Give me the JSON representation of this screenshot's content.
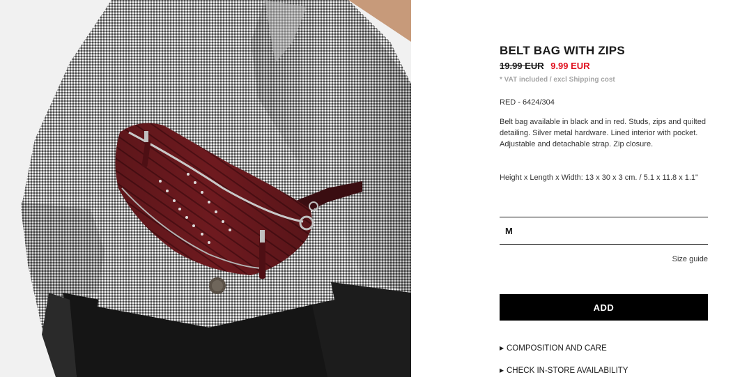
{
  "product": {
    "title": "BELT BAG WITH ZIPS",
    "old_price": "19.99 EUR",
    "new_price": "9.99 EUR",
    "vat_note": "* VAT included / excl Shipping cost",
    "reference": "RED - 6424/304",
    "description": "Belt bag available in black and in red. Studs, zips and quilted detailing. Silver metal hardware. Lined interior with pocket. Adjustable and detachable strap. Zip closure.",
    "dimensions": "Height x Length x Width: 13 x 30 x 3 cm. / 5.1 x 11.8 x 1.1\""
  },
  "size_selector": {
    "selected": "M"
  },
  "size_guide_label": "Size guide",
  "add_button_label": "ADD",
  "info_links": [
    {
      "label": "COMPOSITION AND CARE",
      "icon": "triangle-right-icon"
    },
    {
      "label": "CHECK IN-STORE AVAILABILITY",
      "icon": "triangle-right-icon"
    }
  ],
  "colors": {
    "sale_price": "#e0101e",
    "button_bg": "#000000",
    "bag": "#6e1a1f"
  }
}
